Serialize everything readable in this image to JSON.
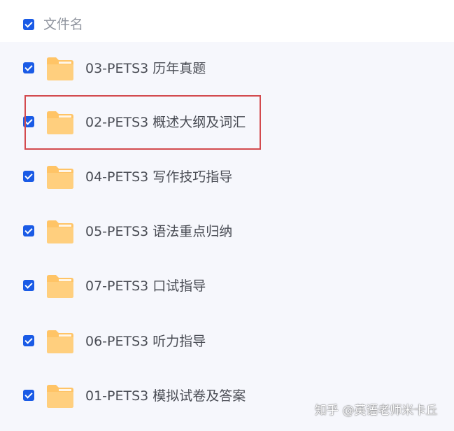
{
  "header": {
    "label": "文件名",
    "checked": true
  },
  "files": [
    {
      "name": "03-PETS3 历年真题",
      "checked": true,
      "icon": "folder-icon"
    },
    {
      "name": "02-PETS3 概述大纲及词汇",
      "checked": true,
      "icon": "folder-icon",
      "highlighted": true
    },
    {
      "name": "04-PETS3 写作技巧指导",
      "checked": true,
      "icon": "folder-icon"
    },
    {
      "name": "05-PETS3 语法重点归纳",
      "checked": true,
      "icon": "folder-icon"
    },
    {
      "name": "07-PETS3 口试指导",
      "checked": true,
      "icon": "folder-icon"
    },
    {
      "name": "06-PETS3 听力指导",
      "checked": true,
      "icon": "folder-icon"
    },
    {
      "name": "01-PETS3 模拟试卷及答案",
      "checked": true,
      "icon": "folder-icon"
    }
  ],
  "watermark": "知乎 @英语老师米卡丘",
  "colors": {
    "checkbox": "#1a5be6",
    "folder": "#ffc466",
    "list_background": "#f6f7fc",
    "highlight_border": "#d34a4e",
    "label_text": "#4a4d55",
    "header_text": "#8f949e"
  }
}
